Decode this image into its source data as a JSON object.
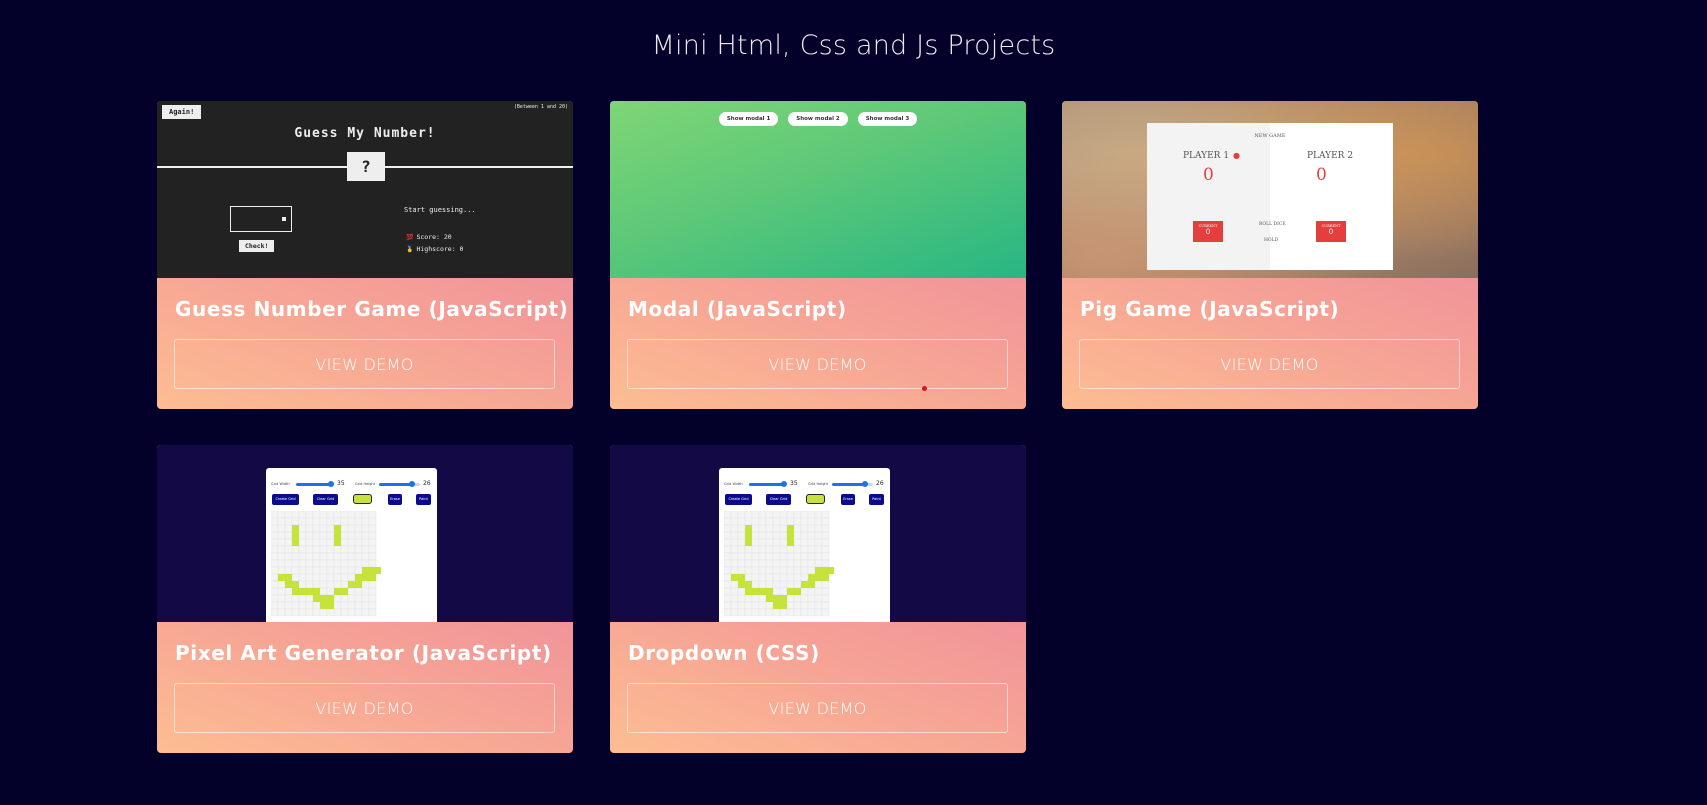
{
  "page": {
    "title": "Mini Html, Css and Js Projects"
  },
  "cards": [
    {
      "title": "Guess Number Game (JavaScript)",
      "button": "VIEW DEMO"
    },
    {
      "title": "Modal (JavaScript)",
      "button": "VIEW DEMO"
    },
    {
      "title": "Pig Game (JavaScript)",
      "button": "VIEW DEMO"
    },
    {
      "title": "Pixel Art Generator (JavaScript)",
      "button": "VIEW DEMO"
    },
    {
      "title": "Dropdown (CSS)",
      "button": "VIEW DEMO"
    }
  ],
  "guess_preview": {
    "again": "Again!",
    "range": "(Between 1 and 20)",
    "title": "Guess My Number!",
    "secret": "?",
    "check": "Check!",
    "message": "Start guessing...",
    "score": "Score: 20",
    "highscore": "Highscore: 0",
    "score_icon": "💯",
    "highscore_icon": "🥇"
  },
  "modal_preview": {
    "buttons": [
      "Show modal 1",
      "Show modal 2",
      "Show modal 3"
    ]
  },
  "pig_preview": {
    "new_game": "NEW GAME",
    "player1": "PLAYER 1",
    "player2": "PLAYER 2",
    "score1": "0",
    "score2": "0",
    "current_label": "CURRENT",
    "current1": "0",
    "current2": "0",
    "roll": "ROLL DICE",
    "hold": "HOLD"
  },
  "pixel_preview": {
    "grid_width_label": "Grid Width",
    "grid_height_label": "Grid Height",
    "grid_width": "35",
    "grid_height": "26",
    "create": "Create Grid",
    "clear": "Clear Grid",
    "erase": "Erase",
    "paint": "Paint",
    "paint_color": "#c5e33b"
  },
  "colors": {
    "background": "#03012a",
    "card_gradient_start": "#fdbd92",
    "card_gradient_end": "#ee889e",
    "accent_red": "#e53e3e"
  }
}
